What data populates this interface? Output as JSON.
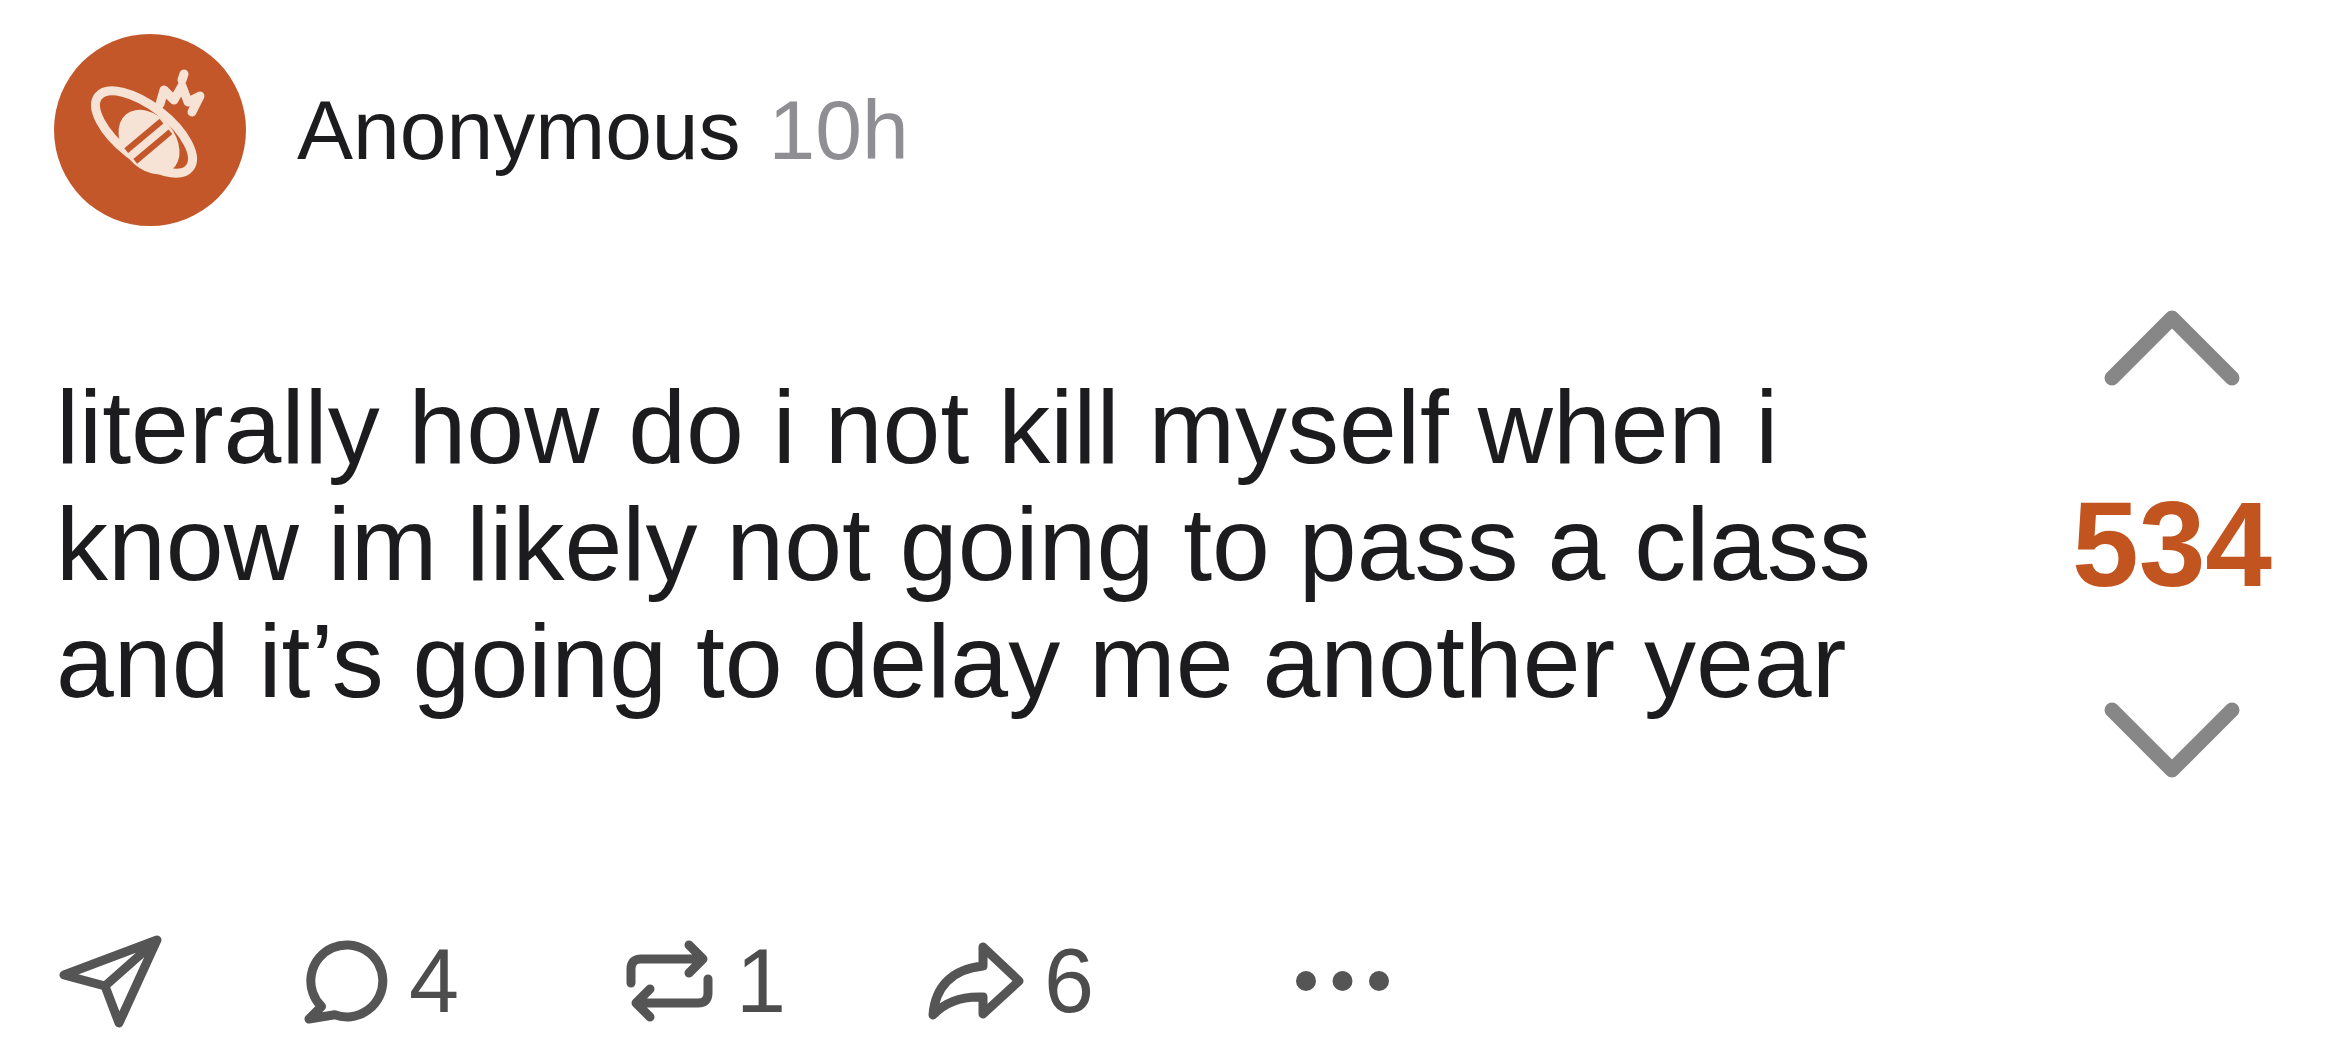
{
  "post": {
    "author": "Anonymous",
    "time": "10h",
    "body": "literally how do i not kill myself when i know im likely not going to pass a class and it’s going to delay me another year",
    "score": "534"
  },
  "actions": [
    {
      "kind": "send"
    },
    {
      "kind": "comment",
      "count": "4"
    },
    {
      "kind": "repost",
      "count": "1"
    },
    {
      "kind": "share",
      "count": "6"
    },
    {
      "kind": "more"
    }
  ]
}
